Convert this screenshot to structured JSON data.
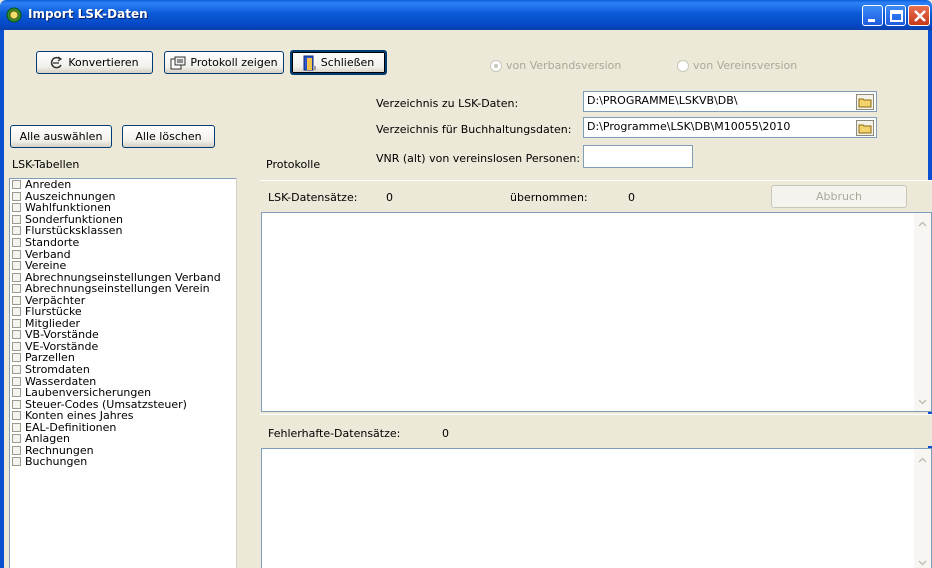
{
  "window": {
    "title": "Import LSK-Daten"
  },
  "toolbar": {
    "konvertieren_label": "Konvertieren",
    "protokoll_label": "Protokoll zeigen",
    "schliessen_label": "Schließen"
  },
  "source": {
    "verbandsversion_label": "von Verbandsversion",
    "vereinsversion_label": "von Vereinsversion",
    "selected": "von Verbandsversion"
  },
  "paths": {
    "lsk_label": "Verzeichnis zu LSK-Daten:",
    "lsk_value": "D:\\PROGRAMME\\LSKVB\\DB\\",
    "buchhaltung_label": "Verzeichnis für Buchhaltungsdaten:",
    "buchhaltung_value": "D:\\Programme\\LSK\\DB\\M10055\\2010",
    "vnr_label": "VNR (alt) von vereinslosen Personen:",
    "vnr_value": ""
  },
  "selection": {
    "alle_auswaehlen": "Alle auswählen",
    "alle_loeschen": "Alle löschen"
  },
  "tables": {
    "header": "LSK-Tabellen",
    "items": [
      "Anreden",
      "Auszeichnungen",
      "Wahlfunktionen",
      "Sonderfunktionen",
      "Flurstücksklassen",
      "Standorte",
      "Verband",
      "Vereine",
      "Abrechnungseinstellungen Verband",
      "Abrechnungseinstellungen Verein",
      "Verpächter",
      "Flurstücke",
      "Mitglieder",
      "VB-Vorstände",
      "VE-Vorstände",
      "Parzellen",
      "Stromdaten",
      "Wasserdaten",
      "Laubenversicherungen",
      "Steuer-Codes (Umsatzsteuer)",
      "Konten eines Jahres",
      "EAL-Definitionen",
      "Anlagen",
      "Rechnungen",
      "Buchungen"
    ]
  },
  "protokolle": {
    "header": "Protokolle",
    "lsk_datensaetze_label": "LSK-Datensätze:",
    "lsk_datensaetze_value": "0",
    "uebernommen_label": "übernommen:",
    "uebernommen_value": "0",
    "abbruch_label": "Abbruch",
    "fehlerhafte_label": "Fehlerhafte-Datensätze:",
    "fehlerhafte_value": "0"
  },
  "colors": {
    "titlebar": "#0A5FDB",
    "face": "#ECE9D8",
    "border": "#7F9DB9"
  }
}
